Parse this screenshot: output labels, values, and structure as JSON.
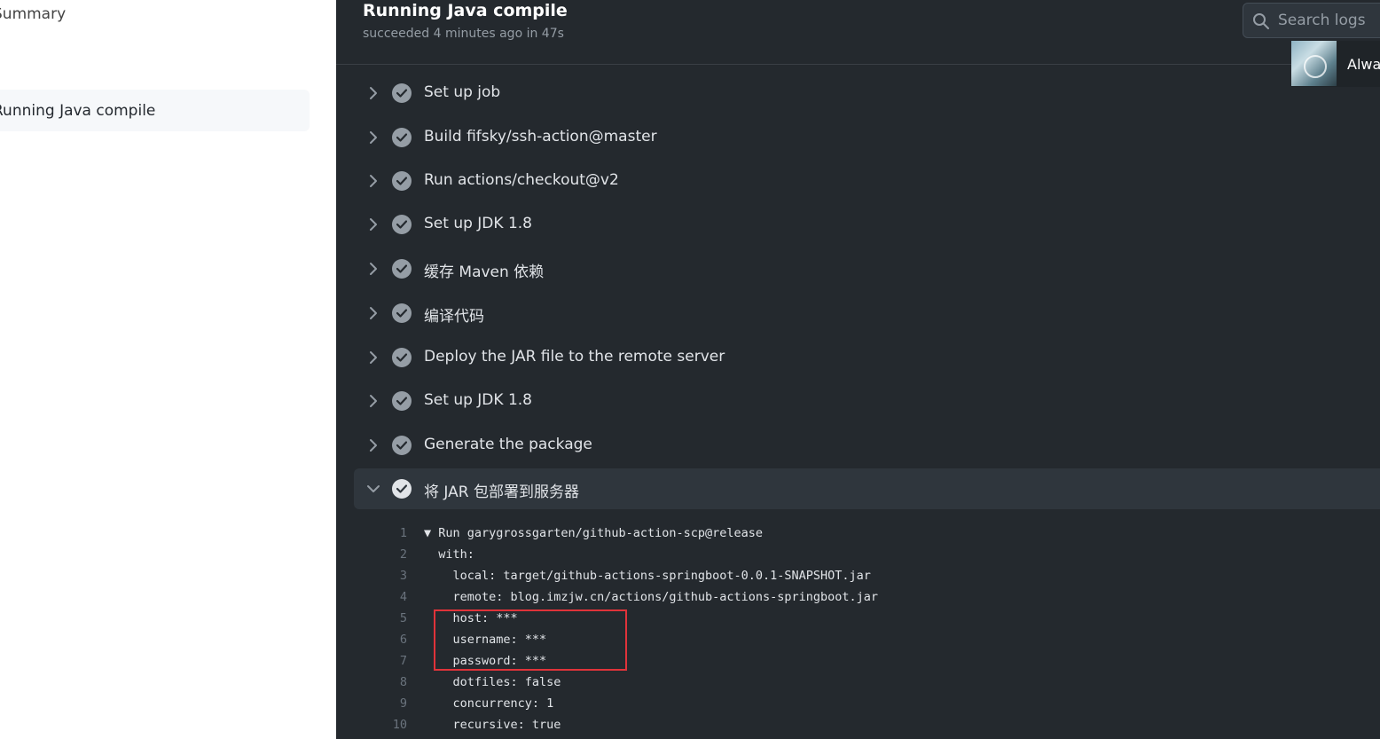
{
  "sidebar": {
    "summary_label": "Summary",
    "job_label": "Running Java compile"
  },
  "header": {
    "title": "Running Java compile",
    "subtitle": "succeeded 4 minutes ago in 47s",
    "search_placeholder": "Search logs",
    "floating_text": "Alway"
  },
  "steps": [
    {
      "label": "Set up job"
    },
    {
      "label": "Build fifsky/ssh-action@master"
    },
    {
      "label": "Run actions/checkout@v2"
    },
    {
      "label": "Set up JDK 1.8"
    },
    {
      "label": "缓存 Maven 依赖"
    },
    {
      "label": "编译代码"
    },
    {
      "label": "Deploy the JAR file to the remote server"
    },
    {
      "label": "Set up JDK 1.8"
    },
    {
      "label": "Generate the package"
    },
    {
      "label": "将 JAR 包部署到服务器",
      "expanded": true
    }
  ],
  "log": [
    {
      "n": "1",
      "text": "▼ Run garygrossgarten/github-action-scp@release"
    },
    {
      "n": "2",
      "text": "  with:"
    },
    {
      "n": "3",
      "text": "    local: target/github-actions-springboot-0.0.1-SNAPSHOT.jar"
    },
    {
      "n": "4",
      "text": "    remote: blog.imzjw.cn/actions/github-actions-springboot.jar"
    },
    {
      "n": "5",
      "text": "    host: ***"
    },
    {
      "n": "6",
      "text": "    username: ***"
    },
    {
      "n": "7",
      "text": "    password: ***"
    },
    {
      "n": "8",
      "text": "    dotfiles: false"
    },
    {
      "n": "9",
      "text": "    concurrency: 1"
    },
    {
      "n": "10",
      "text": "    recursive: true"
    }
  ],
  "colors": {
    "annotation_box": "#e0333a",
    "log_background": "#24292e"
  }
}
